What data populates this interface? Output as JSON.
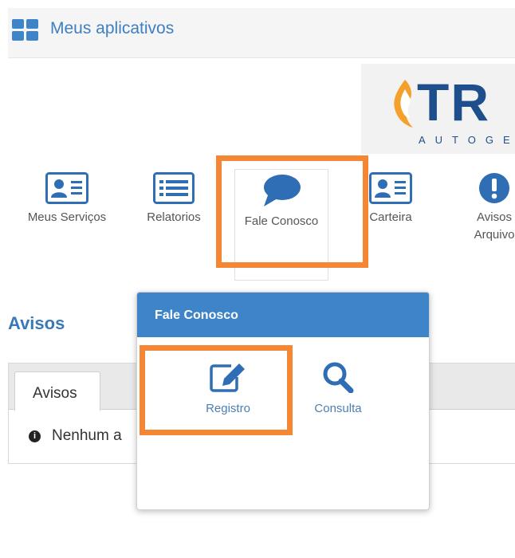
{
  "header": {
    "title": "Meus aplicativos",
    "icon": "apps-grid-icon"
  },
  "logo": {
    "text": "TR",
    "subtitle": "AUTOGE"
  },
  "services": [
    {
      "label": "Meus Serviços",
      "icon": "id-card-icon"
    },
    {
      "label": "Relatorios",
      "icon": "list-icon"
    },
    {
      "label": "Fale Conosco",
      "icon": "speech-bubble-icon"
    },
    {
      "label": "Carteira",
      "icon": "id-card-icon"
    },
    {
      "label": "Avisos\nArquivo",
      "icon": "exclamation-icon"
    }
  ],
  "section": {
    "title": "Avisos"
  },
  "tabs": [
    {
      "label": "Avisos"
    }
  ],
  "notice": {
    "text": "Nenhum a"
  },
  "popup": {
    "title": "Fale Conosco",
    "items": [
      {
        "label": "Registro",
        "icon": "edit-icon"
      },
      {
        "label": "Consulta",
        "icon": "search-icon"
      }
    ]
  },
  "colors": {
    "accent": "#3e84c8",
    "highlight": "#f58634",
    "icon_blue": "#2f6db5"
  }
}
